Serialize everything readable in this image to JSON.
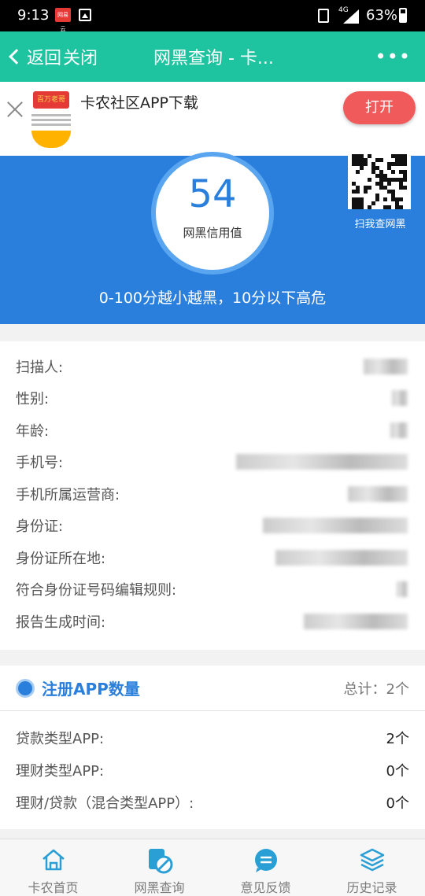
{
  "status": {
    "time": "9:13",
    "news_badge": "网易云",
    "network": "4G",
    "battery": "63%"
  },
  "nav": {
    "back_label": "返回",
    "close_label": "关闭",
    "title": "网黑查询 - 卡...",
    "more": "•••"
  },
  "banner": {
    "title": "卡农社区APP下载",
    "open_label": "打开",
    "logo_text": "百万老哥"
  },
  "hero": {
    "score": "54",
    "score_label": "网黑信用值",
    "scan_label": "扫我查网黑",
    "description": "0-100分越小越黑，10分以下高危"
  },
  "info": {
    "rows": [
      {
        "label": "扫描人:"
      },
      {
        "label": "性别:"
      },
      {
        "label": "年龄:"
      },
      {
        "label": "手机号:"
      },
      {
        "label": "手机所属运营商:"
      },
      {
        "label": "身份证:"
      },
      {
        "label": "身份证所在地:"
      },
      {
        "label": "符合身份证号码编辑规则:"
      },
      {
        "label": "报告生成时间:"
      }
    ]
  },
  "apps": {
    "title": "注册APP数量",
    "total": "总计：2个",
    "rows": [
      {
        "label": "贷款类型APP:",
        "value": "2个"
      },
      {
        "label": "理财类型APP:",
        "value": "0个"
      },
      {
        "label": "理财/贷款（混合类型APP）:",
        "value": "0个"
      }
    ]
  },
  "tabs": [
    {
      "label": "卡农首页"
    },
    {
      "label": "网黑查询"
    },
    {
      "label": "意见反馈"
    },
    {
      "label": "历史记录"
    }
  ],
  "colors": {
    "nav": "#1ec3a0",
    "hero": "#2a7fdc",
    "open_button": "#f05a5a",
    "tab_active": "#2a9fd6"
  }
}
